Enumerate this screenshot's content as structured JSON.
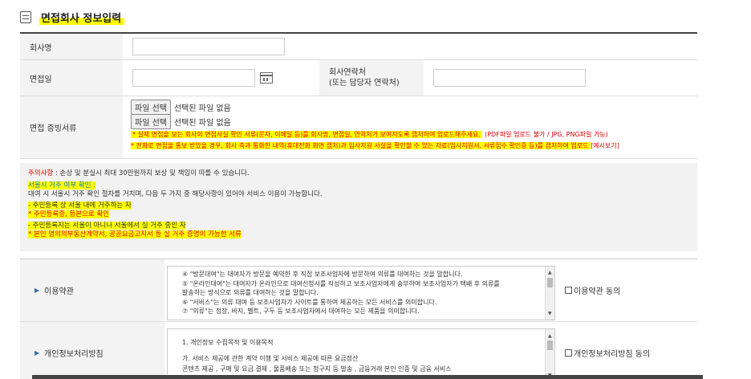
{
  "page": {
    "title": "면접회사 정보입력"
  },
  "form": {
    "company_name": {
      "label": "회사명",
      "value": ""
    },
    "interview_date": {
      "label": "면접일",
      "value": ""
    },
    "company_contact": {
      "label_line1": "회사연락처",
      "label_line2": "(또는 담당자 연락처)",
      "value": ""
    },
    "evidence": {
      "label": "면접 증빙서류",
      "file_button": "파일 선택",
      "no_file": "선택된 파일 없음",
      "note1_main": "* 실제 면접을 보는 회사의 면접사실 확인 서류(문자, 이메일 등)를 회사명, 면접일, 연락처가 보여지도록 캡처하여 업로드해주세요.",
      "note1_extra": "(PDF파일 업로드 불가 / JPG, PNG파일 가능)",
      "note2_main": "* 전화로 면접을 통보 받았을 경우, 회사 측과 통화한 내역(휴대전화 화면 캡처)과 입사지원 사실을 확인할 수 있는 자료(입사지원서, 서류접수 확인증 등)를 캡처하여 업로드 ",
      "note2_link": "[예시보기]"
    }
  },
  "notice": {
    "caution_label": "주의사항",
    "caution_text": " : 손상 및 분실시 최대 30만원까지 보상 및 책임이 따를 수 있습니다.",
    "residence_title": "서울시 거주 여부 확인 :",
    "residence_desc": "대여 시 서울시 거주 확인 절차를 거치며, 다음 두 가지 중 해당사항이 있어야 서비스 이용이 가능합니다.",
    "case1": "- 주민등록 상 서울 내에 거주하는 자",
    "case1_note": "* 주민등록증, 등본으로 확인",
    "case2": "- 주민등록지는 서울이 아니나 서울에서 실 거주 중인 자",
    "case2_note": "* 본인 명의의부동산계약서, 공공요금고지서 등 실 거주 증명이 가능한 서류"
  },
  "terms": {
    "usage": {
      "label": "이용약관",
      "lines": [
        "④ \"방문대여\"는 대여자가 방문을 예약한 후 직접 보조사업자에 방문하여 의류를 대여하는 것을 말합니다.",
        "⑤ \"온라인대여\"는 대여자가 온라인으로 대여신청서를 작성하고 보조사업자에게 송부하여 보조사업자가 택배 후 의류를",
        "발송하는 방식으로 의류를 대여하는 것을 말합니다.",
        "⑥ \"서비스\"는 의류 대여 등 보조사업자가 사이트를 통하여 제공하는 모든 서비스를 의미합니다.",
        "⑦ \"의류\"는 정장, 바지, 벨트, 구두 등 보조사업자에서 대여하는 모든 제품을 의미합니다."
      ],
      "agree": "이용약관 동의"
    },
    "privacy": {
      "label": "개인정보처리방침",
      "lines": [
        "1. 개인정보 수집목적 및 이용목적",
        "",
        "가. 서비스 제공에 관한 계약 이행 및 서비스 제공에 따른 요금정산",
        "콘텐츠 제공 , 구매 및 요금 결제 , 물품배송 또는 청구지 등 발송 , 금융거래 본인 인증 및 금융 서비스"
      ],
      "agree": "개인정보처리방침 동의"
    }
  }
}
